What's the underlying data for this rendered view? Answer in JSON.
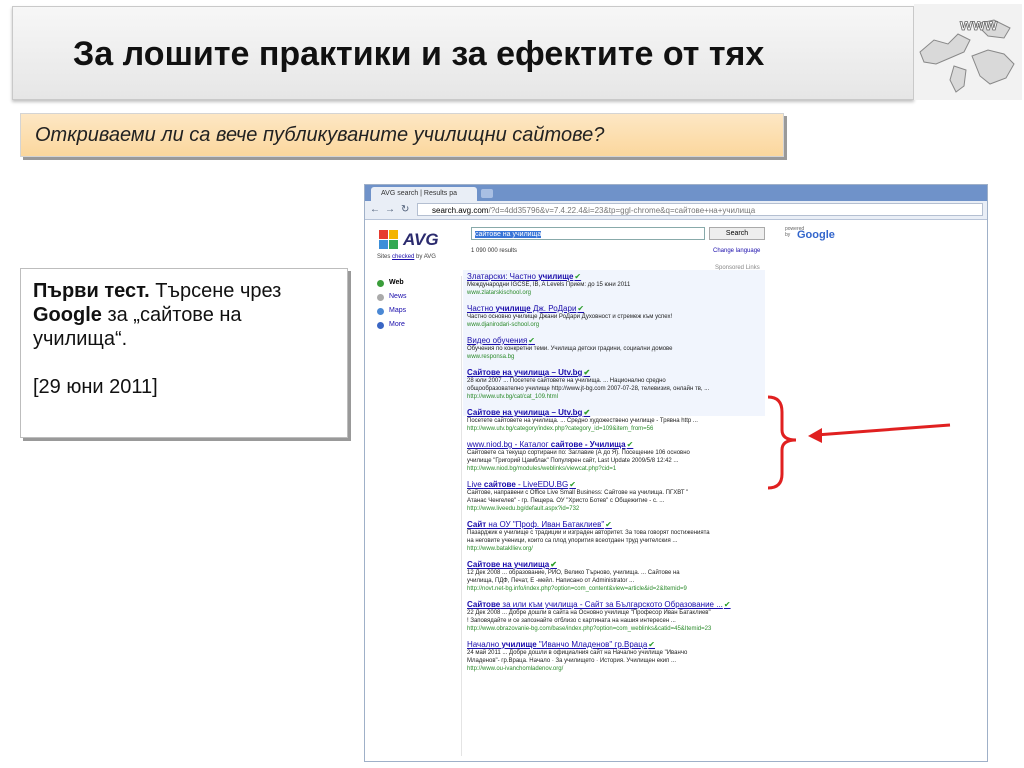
{
  "slide": {
    "title": "За лошите практики и за ефектите от тях",
    "subtitle": "Откриваеми ли са вече публикуваните училищни сайтове?",
    "logo_text": "www",
    "note": {
      "bold1": "Първи тест.",
      "text1": " Търсене чрез ",
      "bold2": "Google",
      "text2": " за „сайтове на училища“.",
      "date": "[29 юни 2011]"
    }
  },
  "browser": {
    "tab_title": "AVG search | Results pa",
    "url_host": "search.avg.com",
    "url_path": "/?d=4dd35796&v=7.4.22.4&i=23&tp=ggl-chrome&q=сайтове+на+училища",
    "avg_logo": "AVG",
    "avg_sub_pre": "Sites ",
    "avg_sub_link": "checked",
    "avg_sub_post": " by AVG",
    "search_query": "сайтове на училища",
    "search_button": "Search",
    "powered_by": "powered by",
    "google": "Google",
    "result_count": "1 090 000 results",
    "change_language": "Change language",
    "sponsored_links": "Sponsored Links",
    "nav": [
      {
        "label": "Web",
        "color": "#3a9d3a"
      },
      {
        "label": "News",
        "color": "#aaaaaa"
      },
      {
        "label": "Maps",
        "color": "#4a88d4"
      },
      {
        "label": "More",
        "color": "#3a66c4"
      }
    ],
    "results": [
      {
        "title_a": "Златарски: Частно ",
        "title_b": "училище",
        "title_c": "",
        "bold_title": false,
        "snip1": "Международни IGCSE, IB, A Levels Прием: до 15 юни 2011",
        "snip2": "",
        "url": "www.zlatarskischool.org"
      },
      {
        "title_a": "Частно ",
        "title_b": "училище",
        "title_c": " Дж. РоДари",
        "bold_title": false,
        "snip1": "Частно основно училище Джани РоДари Духовност и стремеж към успех!",
        "snip2": "",
        "url": "www.djanirodari-school.org"
      },
      {
        "title_a": "Видео обучения",
        "title_b": "",
        "title_c": "",
        "bold_title": false,
        "snip1": "Обучения по конкретни теми. Училища детски градини, социални домове",
        "snip2": "",
        "url": "www.responsa.bg"
      },
      {
        "title_a": "",
        "title_b": "Сайтове на училища",
        "title_c": " – Utv.bg",
        "bold_title": true,
        "snip1": "28 юли 2007 ... Посетете сайтовете на училища. ... Национално средно",
        "snip2": "общообразователно училище http://www.jt-bg.com 2007-07-28, телевизия, онлайн тв, ...",
        "url": "http://www.utv.bg/cat/cat_109.html"
      },
      {
        "title_a": "",
        "title_b": "Сайтове на училища",
        "title_c": " – Utv.bg",
        "bold_title": true,
        "snip1": "Посетете сайтовете на училища. ... Средно художествено училище - Трявна http ...",
        "snip2": "",
        "url": "http://www.utv.bg/category/index.php?category_id=109&item_from=56"
      },
      {
        "title_a": "www.niod.bg - Каталог ",
        "title_b": "сайтове - Училища",
        "title_c": "",
        "bold_title": false,
        "snip1": "Сайтовете са текущо сортирани по: Заглавие (А до Я). Посещение 106 основно",
        "snip2": "училище \"Григорий Цамблак\" Популярен сайт, Last Update 2009/5/8 12:42 ...",
        "url": "http://www.niod.bg/modules/weblinks/viewcat.php?cid=1"
      },
      {
        "title_a": "Live ",
        "title_b": "сайтове",
        "title_c": " - LiveEDU.BG",
        "bold_title": false,
        "snip1": "Сайтове, направени с Office Live Small Business: Сайтове на училища. ПГХВТ \"",
        "snip2": "Атанас Ченгелев\" - гр. Пещера. ОУ \"Христо Ботев\" с Общежитие - с. ...",
        "url": "http://www.liveedu.bg/default.aspx?id=732"
      },
      {
        "title_a": "",
        "title_b": "Сайт",
        "title_c": " на ОУ \"Проф. Иван Батаклиев\"",
        "bold_title": false,
        "snip1": "Пазарджик е училище с традиции и изграден авторитет. За това говорят постиженията",
        "snip2": "на неговите ученици, които са плод упорития всеотдаен труд учителския ...",
        "url": "http://www.bataklliev.org/"
      },
      {
        "title_a": "",
        "title_b": "Сайтове на училища",
        "title_c": "",
        "bold_title": true,
        "snip1": "12 Дек 2008 ... образование, РИО, Велико Търново, училища. ... Сайтове на",
        "snip2": "училища, ПДФ, Печат, Е -мейл. Написано от Administrator ...",
        "url": "http://novt.net-bg.info/index.php?option=com_content&view=article&id=2&Itemid=9"
      },
      {
        "title_a": "",
        "title_b": "Сайтове",
        "title_c": " за или към училища - Сайт за Българското Образование ...",
        "bold_title": false,
        "snip1": "22 Дек 2008 ... Добре дошли в сайта на Основно училище \"Професор Иван Батаклиев\"",
        "snip2": "! Заповядайте и се запознайте отблизо с картината на нашия интересен ...",
        "url": "http://www.obrazovanie-bg.com/base/index.php?option=com_weblinks&catid=45&Itemid=23"
      },
      {
        "title_a": "Начално ",
        "title_b": "училище",
        "title_c": " \"Иванчо Младенов\" гр.Враца",
        "bold_title": false,
        "snip1": "24 май 2011 ... Добре дошли в официалния сайт на Начално училище \"Иванчо",
        "snip2": "Младенов\"- гр.Враца. Начало · За училището · История. Училищен екип ...",
        "url": "http://www.ou-ivanchomladenov.org/"
      }
    ]
  },
  "colors": {
    "annotation_red": "#e02020",
    "subtitle_bg": "#fbd79d"
  }
}
